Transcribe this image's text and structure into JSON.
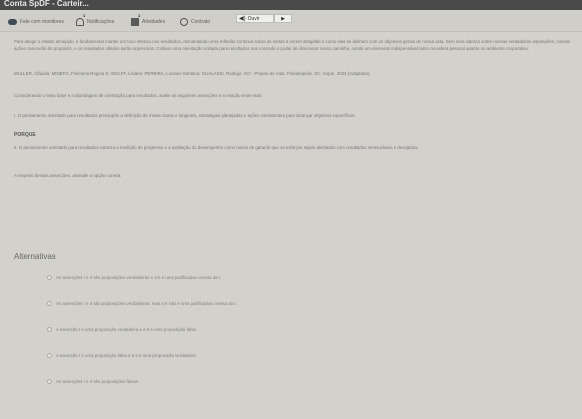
{
  "window": {
    "title": "Conta SpDF - Carteir..."
  },
  "nav": {
    "chat_label": "Fale com monitores",
    "notifications_label": "Notificações",
    "notifications_badge": "1",
    "activities_label": "Atividades",
    "activities_badge": "1",
    "contract_label": "Contrato",
    "listen_label": "Ouvir",
    "play_symbol": "▶"
  },
  "question": {
    "intro": "Para atingir o estado almejado, é fundamental manter um foco intenso nos resultados, demandando uma reflexão contínua sobre as metas a serem atingidas e como elas se alinham com os objetivos gerais de nossa vida. Sem uma clareza sobre nossas verdadeiras aspirações, nossas ações carecerão de propósito, e os resultados obtidos serão imprecisos. Cultivar uma orientação voltada para resultados nos concede o poder de direcionar nosso caminho, sendo um elemento indispensável tanto na esfera pessoal quanto no ambiente corporativo.",
    "citation": "MULLER, Cláudia; MINETO, Filomena Regina S; WOLFF, Lisiane; PEREIRA, Luciano Santana; GUALASSI, Rodrigo. GO - Projeto de Vida. Florianópolis, SC: Arqué, 2023 (Adaptado).",
    "instruction": "Considerando o texto base e a abordagem de orientação para resultados, avalie as seguintes asserções e a relação entre elas:",
    "assertion_1": "I. O pensamento orientado para resultados pressupõe a definição de metas claras e tangíveis, estratégias planejadas e ações consistentes para alcançar objetivos específicos.",
    "connector": "PORQUE",
    "assertion_2": "II. O pensamento orientado para resultados valoriza a medição do progresso e a avaliação do desempenho como meios de garantir que os esforços sejam alinhados com resultados mensuráveis e desejados.",
    "prompt": "A respeito dessas asserções, assinale a opção correta."
  },
  "alternatives": {
    "title": "Alternativas",
    "options": [
      "As asserções I e II são proposições verdadeiras e a II é uma justificativa correta da I.",
      "As asserções I e II são proposições verdadeiras, mas a II não é uma justificativa correta da I.",
      "A asserção I é uma proposição verdadeira e a II é uma proposição falsa.",
      "A asserção I é uma proposição falsa e a II é uma proposição verdadeira.",
      "As asserções I e II são proposições falsas."
    ]
  }
}
